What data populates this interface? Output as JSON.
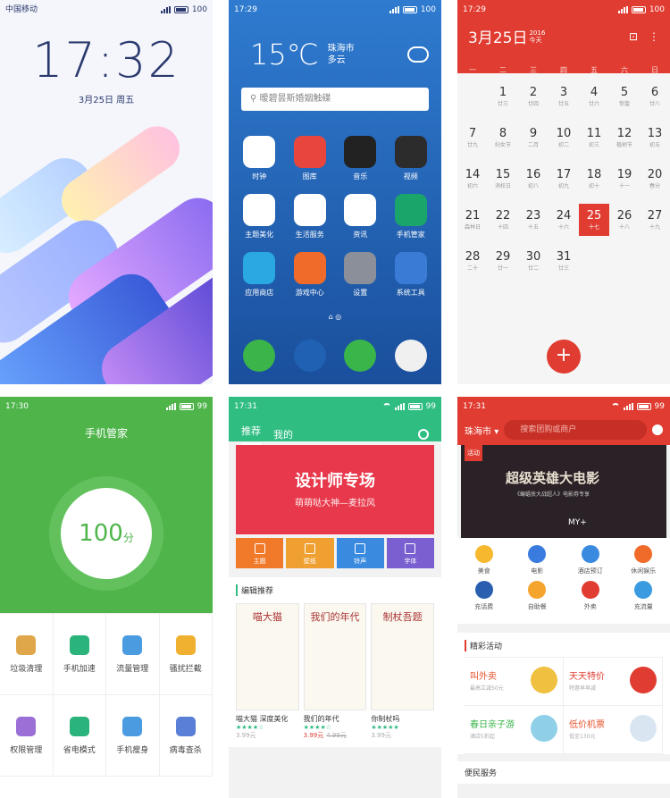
{
  "lock": {
    "carrier": "中国移动",
    "battery": "100",
    "time": "17:32",
    "date": "3月25日 周五"
  },
  "home": {
    "status_time": "17:29",
    "battery": "100",
    "temp": "15℃",
    "city": "珠海市",
    "weather": "多云",
    "search": "暧碧昙斯婚姻触碟",
    "apps": [
      {
        "label": "时钟",
        "color": "#ffffff",
        "icon": "clock-icon"
      },
      {
        "label": "图库",
        "color": "#e8453c",
        "icon": "gallery-icon"
      },
      {
        "label": "音乐",
        "color": "#222222",
        "icon": "music-icon"
      },
      {
        "label": "视频",
        "color": "#2c2c2c",
        "icon": "video-icon"
      },
      {
        "label": "主题美化",
        "color": "#ffffff",
        "icon": "theme-icon"
      },
      {
        "label": "生活服务",
        "color": "#ffffff",
        "icon": "location-icon"
      },
      {
        "label": "资讯",
        "color": "#ffffff",
        "icon": "news-icon"
      },
      {
        "label": "手机管家",
        "color": "#1aa56a",
        "icon": "umbrella-icon"
      },
      {
        "label": "应用商店",
        "color": "#2aa8e0",
        "icon": "store-icon"
      },
      {
        "label": "游戏中心",
        "color": "#f06a2a",
        "icon": "gamepad-icon"
      },
      {
        "label": "设置",
        "color": "#8a8f99",
        "icon": "gear-icon"
      },
      {
        "label": "系统工具",
        "color": "#3a7bd5",
        "icon": "tools-icon"
      }
    ],
    "dock": [
      {
        "color": "#3bb54a",
        "icon": "phone-icon"
      },
      {
        "color": "#2061b3",
        "icon": "browser-icon"
      },
      {
        "color": "#39b54a",
        "icon": "message-icon"
      },
      {
        "color": "#f0f0f0",
        "icon": "camera-icon"
      }
    ]
  },
  "calendar": {
    "status_time": "17:29",
    "battery": "100",
    "title": "3月25日",
    "year": "2016",
    "today": "今天",
    "weekdays": [
      "一",
      "二",
      "三",
      "四",
      "五",
      "六",
      "日"
    ],
    "days": [
      {
        "d": "",
        "l": ""
      },
      {
        "d": "1",
        "l": "廿三"
      },
      {
        "d": "2",
        "l": "廿四"
      },
      {
        "d": "3",
        "l": "廿五"
      },
      {
        "d": "4",
        "l": "廿六"
      },
      {
        "d": "5",
        "l": "惊蛰"
      },
      {
        "d": "6",
        "l": "廿八"
      },
      {
        "d": "7",
        "l": "廿九"
      },
      {
        "d": "8",
        "l": "妇女节"
      },
      {
        "d": "9",
        "l": "二月"
      },
      {
        "d": "10",
        "l": "初二"
      },
      {
        "d": "11",
        "l": "初三"
      },
      {
        "d": "12",
        "l": "植树节"
      },
      {
        "d": "13",
        "l": "初五"
      },
      {
        "d": "14",
        "l": "初六"
      },
      {
        "d": "15",
        "l": "消权日"
      },
      {
        "d": "16",
        "l": "初八"
      },
      {
        "d": "17",
        "l": "初九"
      },
      {
        "d": "18",
        "l": "初十"
      },
      {
        "d": "19",
        "l": "十一"
      },
      {
        "d": "20",
        "l": "春分"
      },
      {
        "d": "21",
        "l": "森林日"
      },
      {
        "d": "22",
        "l": "十四"
      },
      {
        "d": "23",
        "l": "十五"
      },
      {
        "d": "24",
        "l": "十六"
      },
      {
        "d": "25",
        "l": "十七"
      },
      {
        "d": "26",
        "l": "十八"
      },
      {
        "d": "27",
        "l": "十九"
      },
      {
        "d": "28",
        "l": "二十"
      },
      {
        "d": "29",
        "l": "廿一"
      },
      {
        "d": "30",
        "l": "廿二"
      },
      {
        "d": "31",
        "l": "廿三"
      }
    ],
    "today_index": 25,
    "fab": "+"
  },
  "manager": {
    "status_time": "17:30",
    "battery": "99",
    "title": "手机管家",
    "score": "100",
    "unit": "分",
    "tools": [
      {
        "label": "垃圾清理",
        "color": "#e0a64a",
        "icon": "broom-icon"
      },
      {
        "label": "手机加速",
        "color": "#2ab37a",
        "icon": "speed-icon"
      },
      {
        "label": "流量管理",
        "color": "#4a9be0",
        "icon": "data-icon"
      },
      {
        "label": "骚扰拦截",
        "color": "#f0b030",
        "icon": "umbrella-icon"
      },
      {
        "label": "权限管理",
        "color": "#9a6fd6",
        "icon": "lock-icon"
      },
      {
        "label": "省电模式",
        "color": "#2ab37a",
        "icon": "battery-icon"
      },
      {
        "label": "手机瘦身",
        "color": "#4a9be0",
        "icon": "pie-icon"
      },
      {
        "label": "病毒查杀",
        "color": "#5a7fd6",
        "icon": "shield-icon"
      }
    ]
  },
  "store": {
    "status_time": "17:31",
    "battery": "99",
    "tabs": [
      "推荐",
      "我的"
    ],
    "banner_title": "设计师专场",
    "banner_sub": "萌萌哒大神—麦拉风",
    "cats": [
      {
        "label": "主题",
        "color": "#f07a2a"
      },
      {
        "label": "壁纸",
        "color": "#f0a030"
      },
      {
        "label": "铃声",
        "color": "#3a8be0"
      },
      {
        "label": "字体",
        "color": "#7a5fd0"
      }
    ],
    "section": "编辑推荐",
    "items": [
      {
        "name": "喵大猫 深度美化",
        "art": "喵大猫",
        "stars": "★★★★☆",
        "price": "3.99元",
        "old": ""
      },
      {
        "name": "我们的年代",
        "art": "我们的年代",
        "stars": "★★★★☆",
        "price": "3.99元",
        "old": "4.99元"
      },
      {
        "name": "你制杖吗",
        "art": "制杖吾题",
        "stars": "★★★★★",
        "price": "3.99元",
        "old": ""
      }
    ]
  },
  "meituan": {
    "status_time": "17:31",
    "battery": "99",
    "city": "珠海市",
    "search": "搜索团购或商户",
    "banner_tag": "活动",
    "banner_title": "超级英雄大电影",
    "banner_sub": "《蝙蝠侠大战超人》电影券专享",
    "banner_brand": "MY+",
    "cats": [
      {
        "label": "美食",
        "color": "#f5b82e"
      },
      {
        "label": "电影",
        "color": "#3a7be0"
      },
      {
        "label": "酒店预订",
        "color": "#3a8be0"
      },
      {
        "label": "休闲娱乐",
        "color": "#f06a2a"
      },
      {
        "label": "充话费",
        "color": "#2a5fb0"
      },
      {
        "label": "自助餐",
        "color": "#f5a52e"
      },
      {
        "label": "外卖",
        "color": "#e03c31"
      },
      {
        "label": "充流量",
        "color": "#3a9be0"
      }
    ],
    "section": "精彩活动",
    "deals": [
      {
        "a": "叫外卖",
        "b": "最高立减50元",
        "c": "#e8532e",
        "pic": "#f0c040"
      },
      {
        "a": "天天特价",
        "b": "特惠早早减",
        "c": "#e03c31",
        "pic": "#e03c31"
      },
      {
        "a": "春日亲子游",
        "b": "酒店5折起",
        "c": "#39b54a",
        "pic": "#8fd0e8"
      },
      {
        "a": "低价机票",
        "b": "低至130元",
        "c": "#e8532e",
        "pic": "#d9e6f2"
      }
    ],
    "section2": "便民服务"
  }
}
